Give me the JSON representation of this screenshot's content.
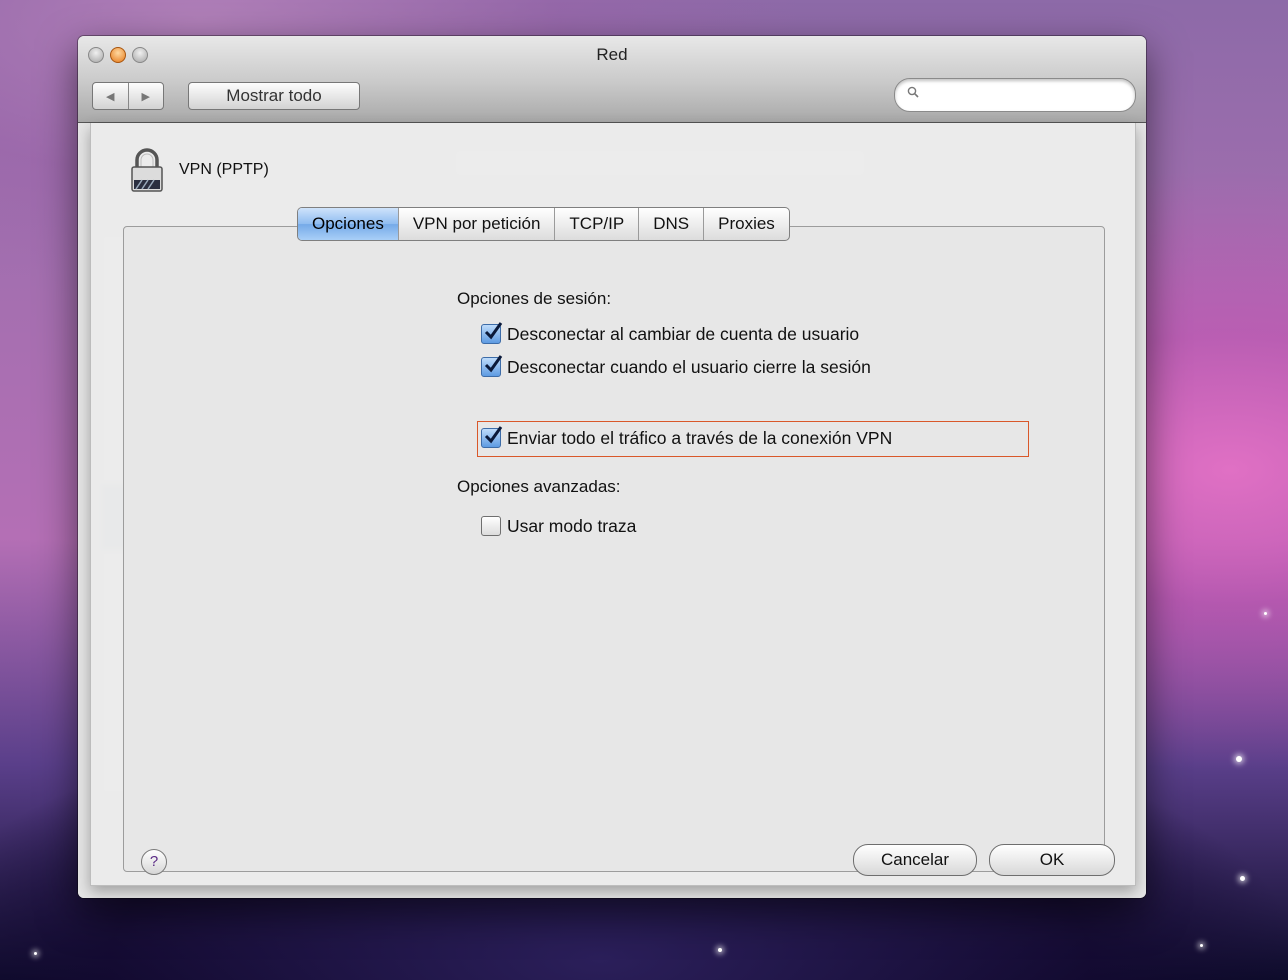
{
  "window": {
    "title": "Red"
  },
  "toolbar": {
    "show_all_label": "Mostrar todo",
    "search_placeholder": ""
  },
  "sheet": {
    "service_name": "VPN (PPTP)",
    "tabs": [
      {
        "label": "Opciones",
        "active": true
      },
      {
        "label": "VPN por petición",
        "active": false
      },
      {
        "label": "TCP/IP",
        "active": false
      },
      {
        "label": "DNS",
        "active": false
      },
      {
        "label": "Proxies",
        "active": false
      }
    ],
    "session_options": {
      "heading": "Opciones de sesión:",
      "items": [
        {
          "label": "Desconectar al cambiar de cuenta de usuario",
          "checked": true
        },
        {
          "label": "Desconectar cuando el usuario cierre la sesión",
          "checked": true
        },
        {
          "label": "Enviar todo el tráfico a través de la conexión VPN",
          "checked": true,
          "highlighted": true
        }
      ]
    },
    "advanced_options": {
      "heading": "Opciones avanzadas:",
      "items": [
        {
          "label": "Usar modo traza",
          "checked": false
        }
      ]
    },
    "help_label": "?",
    "cancel_label": "Cancelar",
    "ok_label": "OK"
  },
  "colors": {
    "highlight_box": "#d9582a",
    "active_tab": "#8fbcf0"
  }
}
